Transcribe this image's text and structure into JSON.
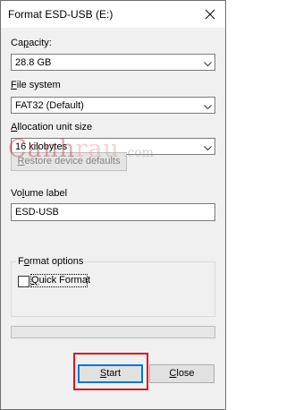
{
  "window": {
    "title": "Format ESD-USB (E:)"
  },
  "capacity": {
    "label": "Capacity:",
    "value": "28.8 GB"
  },
  "file_system": {
    "label": "File system",
    "value": "FAT32 (Default)"
  },
  "allocation": {
    "label": "Allocation unit size",
    "value": "16 kilobytes"
  },
  "restore_button": {
    "label": "Restore device defaults"
  },
  "volume_label": {
    "label": "Volume label",
    "value": "ESD-USB"
  },
  "format_options": {
    "legend": "Format options",
    "quick_format_label": "Quick Format",
    "quick_format_checked": false
  },
  "progress": {
    "value": 0
  },
  "buttons": {
    "start": "Start",
    "close": "Close"
  },
  "watermark": {
    "part1": "Canh",
    "part2": "rau",
    "part3": ".com"
  },
  "colors": {
    "highlight": "#e0141e",
    "accent": "#0078d7"
  }
}
